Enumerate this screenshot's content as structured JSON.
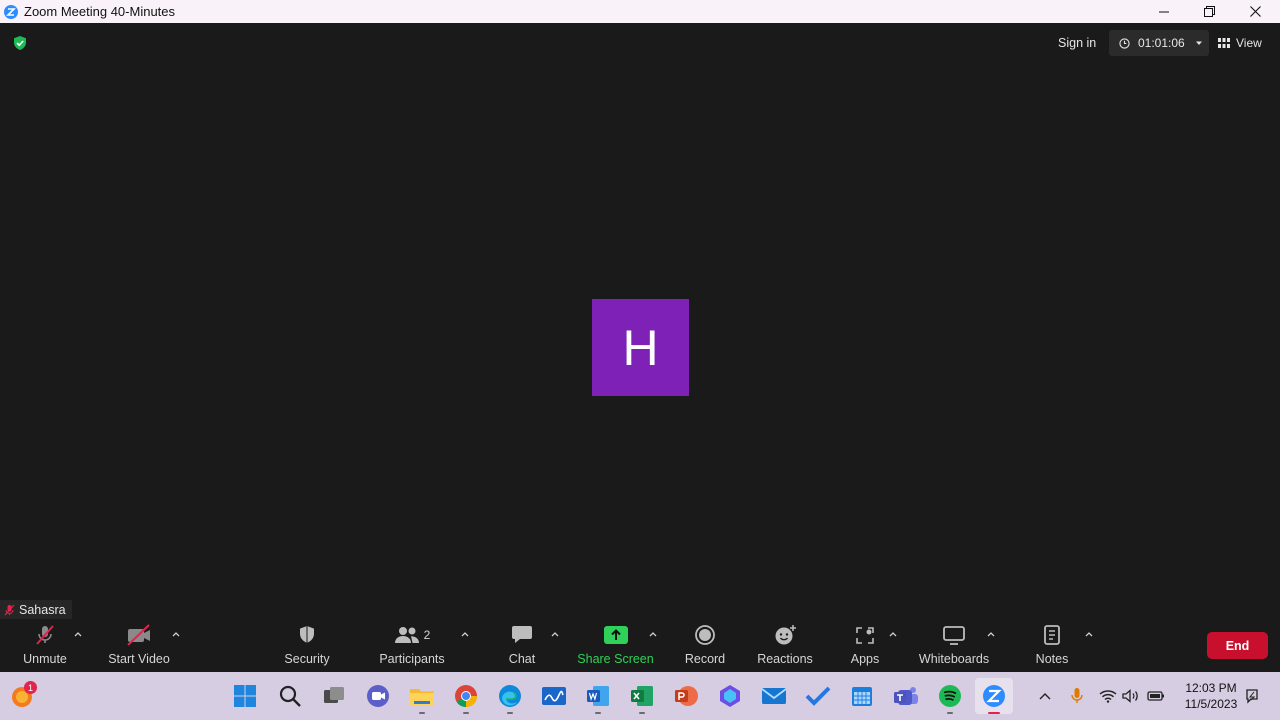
{
  "window": {
    "title": "Zoom Meeting 40-Minutes",
    "min_icon": "minimize-icon",
    "max_icon": "restore-icon",
    "close_icon": "close-icon"
  },
  "meeting": {
    "sign_in": "Sign in",
    "timer": "01:01:06",
    "view": "View",
    "avatar_letter": "H",
    "avatar_color": "#7e22b7",
    "participant_name": "Sahasra"
  },
  "toolbar": {
    "unmute": "Unmute",
    "start_video": "Start Video",
    "security": "Security",
    "participants": "Participants",
    "participants_count": "2",
    "chat": "Chat",
    "share_screen": "Share Screen",
    "record": "Record",
    "reactions": "Reactions",
    "apps": "Apps",
    "whiteboards": "Whiteboards",
    "notes": "Notes",
    "end": "End",
    "share_color": "#2fd158",
    "end_color": "#c8102e"
  },
  "taskbar": {
    "badge": "1",
    "time": "12:03 PM",
    "date": "11/5/2023",
    "apps": [
      "start",
      "search",
      "task-view",
      "meet",
      "file-explorer",
      "chrome",
      "edge",
      "whiteboard",
      "word",
      "excel",
      "powerpoint",
      "copilot",
      "mail",
      "todo",
      "calendar",
      "teams",
      "spotify",
      "zoom"
    ]
  }
}
